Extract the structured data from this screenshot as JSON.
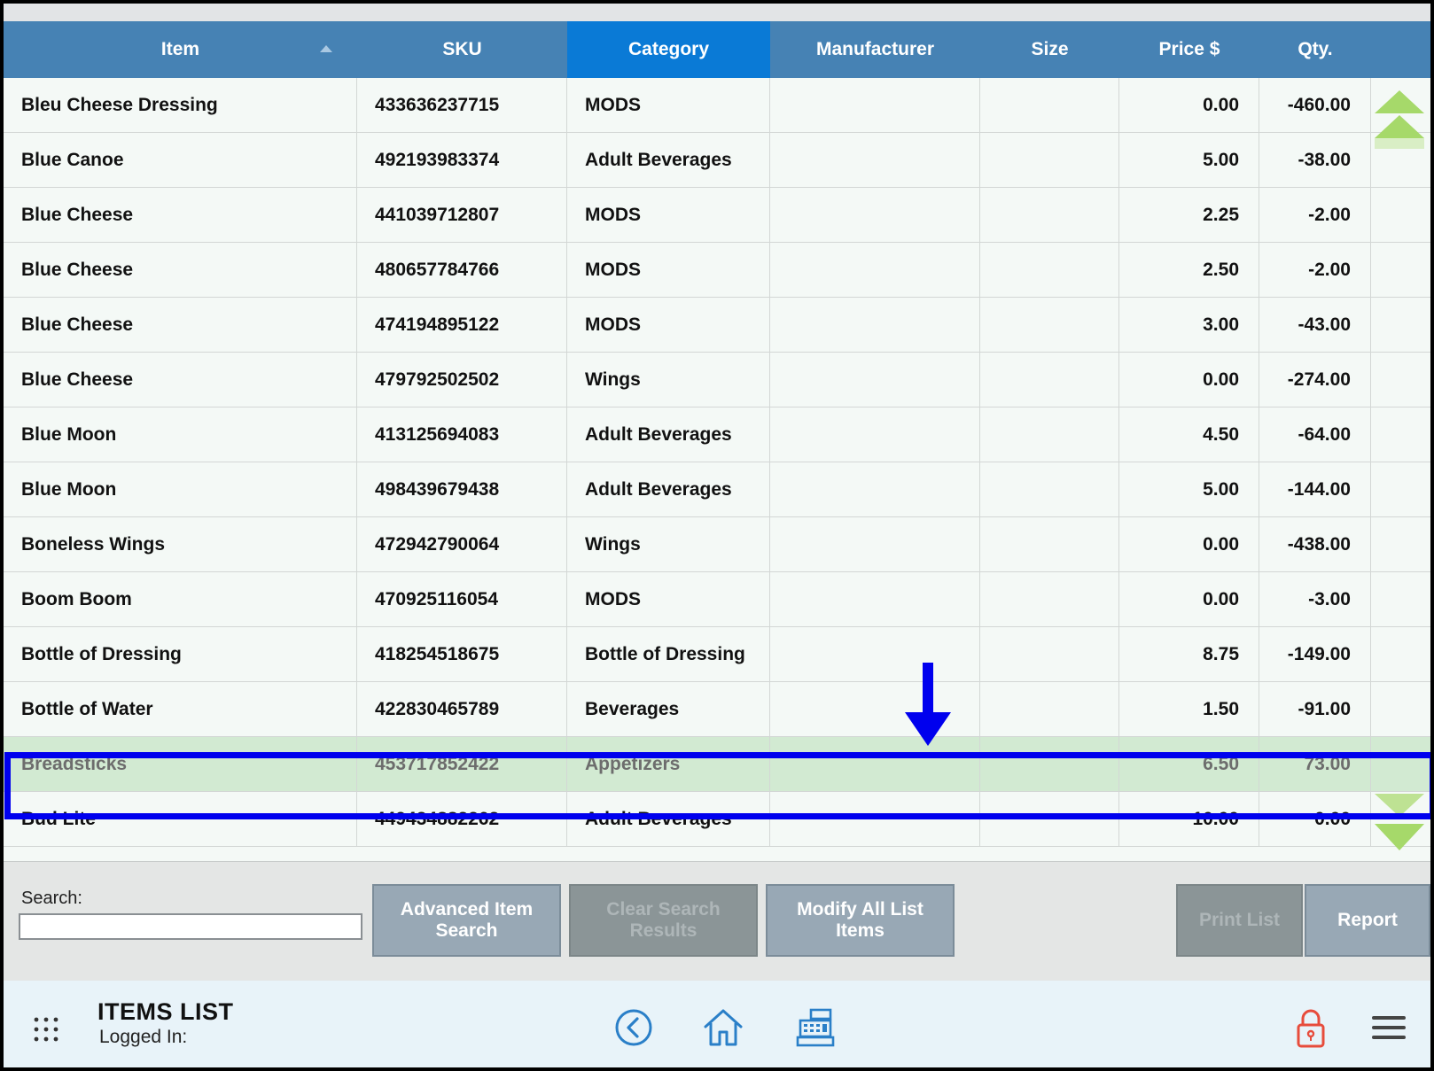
{
  "colors": {
    "header_bg": "#4682b4",
    "header_active": "#0a7ad6",
    "row_bg": "#f4f9f6",
    "selected_row_bg": "#d2ead2",
    "highlight": "#0000ee",
    "scroll_arrow": "#a6d96a",
    "button_enabled": "#98a8b5",
    "button_disabled": "#8b9597",
    "footer_bg": "#e8f3f9",
    "lock_icon": "#e74c3c"
  },
  "table": {
    "headers": {
      "item": "Item",
      "sku": "SKU",
      "category": "Category",
      "manufacturer": "Manufacturer",
      "size": "Size",
      "price": "Price $",
      "qty": "Qty."
    },
    "sorted_column": "item",
    "active_column": "category",
    "rows": [
      {
        "item": "Bleu Cheese Dressing",
        "sku": "433636237715",
        "category": "MODS",
        "manufacturer": "",
        "size": "",
        "price": "0.00",
        "qty": "-460.00"
      },
      {
        "item": "Blue Canoe",
        "sku": "492193983374",
        "category": "Adult Beverages",
        "manufacturer": "",
        "size": "",
        "price": "5.00",
        "qty": "-38.00"
      },
      {
        "item": "Blue Cheese",
        "sku": "441039712807",
        "category": "MODS",
        "manufacturer": "",
        "size": "",
        "price": "2.25",
        "qty": "-2.00"
      },
      {
        "item": "Blue Cheese",
        "sku": "480657784766",
        "category": "MODS",
        "manufacturer": "",
        "size": "",
        "price": "2.50",
        "qty": "-2.00"
      },
      {
        "item": "Blue Cheese",
        "sku": "474194895122",
        "category": "MODS",
        "manufacturer": "",
        "size": "",
        "price": "3.00",
        "qty": "-43.00"
      },
      {
        "item": "Blue Cheese",
        "sku": "479792502502",
        "category": "Wings",
        "manufacturer": "",
        "size": "",
        "price": "0.00",
        "qty": "-274.00"
      },
      {
        "item": "Blue Moon",
        "sku": "413125694083",
        "category": "Adult Beverages",
        "manufacturer": "",
        "size": "",
        "price": "4.50",
        "qty": "-64.00"
      },
      {
        "item": "Blue Moon",
        "sku": "498439679438",
        "category": "Adult Beverages",
        "manufacturer": "",
        "size": "",
        "price": "5.00",
        "qty": "-144.00"
      },
      {
        "item": "Boneless Wings",
        "sku": "472942790064",
        "category": "Wings",
        "manufacturer": "",
        "size": "",
        "price": "0.00",
        "qty": "-438.00"
      },
      {
        "item": "Boom Boom",
        "sku": "470925116054",
        "category": "MODS",
        "manufacturer": "",
        "size": "",
        "price": "0.00",
        "qty": "-3.00"
      },
      {
        "item": "Bottle of Dressing",
        "sku": "418254518675",
        "category": "Bottle of Dressing",
        "manufacturer": "",
        "size": "",
        "price": "8.75",
        "qty": "-149.00"
      },
      {
        "item": "Bottle of Water",
        "sku": "422830465789",
        "category": "Beverages",
        "manufacturer": "",
        "size": "",
        "price": "1.50",
        "qty": "-91.00"
      },
      {
        "item": "Breadsticks",
        "sku": "453717852422",
        "category": "Appetizers",
        "manufacturer": "",
        "size": "",
        "price": "6.50",
        "qty": "73.00",
        "selected": true
      },
      {
        "item": "Bud Lite",
        "sku": "449434882262",
        "category": "Adult Beverages",
        "manufacturer": "",
        "size": "",
        "price": "10.00",
        "qty": "0.00"
      }
    ]
  },
  "toolbar": {
    "search_label": "Search:",
    "search_value": "",
    "buttons": {
      "advanced_search": "Advanced Item Search",
      "clear_search": "Clear Search Results",
      "modify_all": "Modify All List Items",
      "print_list": "Print List",
      "report": "Report"
    }
  },
  "footer": {
    "title": "ITEMS LIST",
    "logged_in": "Logged In:",
    "icons": [
      "apps-grid-icon",
      "back-icon",
      "home-icon",
      "cash-register-icon",
      "lock-icon",
      "hamburger-menu-icon"
    ]
  }
}
